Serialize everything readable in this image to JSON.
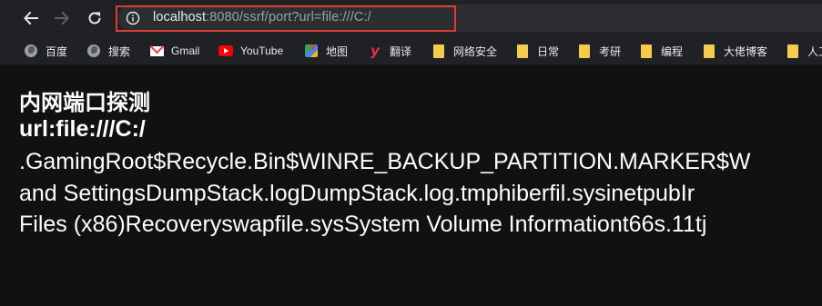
{
  "toolbar": {
    "url_host": "localhost",
    "url_rest": ":8080/ssrf/port?url=file:///C:/"
  },
  "bookmarks": [
    {
      "label": "百度",
      "icon": "globe-icon"
    },
    {
      "label": "搜索",
      "icon": "globe-icon"
    },
    {
      "label": "Gmail",
      "icon": "gmail-icon"
    },
    {
      "label": "YouTube",
      "icon": "youtube-icon"
    },
    {
      "label": "地图",
      "icon": "maps-icon"
    },
    {
      "label": "翻译",
      "icon": "youdao-icon"
    },
    {
      "label": "网络安全",
      "icon": "folder-icon"
    },
    {
      "label": "日常",
      "icon": "folder-icon"
    },
    {
      "label": "考研",
      "icon": "folder-icon"
    },
    {
      "label": "编程",
      "icon": "folder-icon"
    },
    {
      "label": "大佬博客",
      "icon": "folder-icon"
    },
    {
      "label": "人工",
      "icon": "folder-icon"
    }
  ],
  "page": {
    "title": "内网端口探测",
    "url_line": "url:file:///C:/",
    "listing": [
      ".GamingRoot$Recycle.Bin$WINRE_BACKUP_PARTITION.MARKER$W",
      "and SettingsDumpStack.logDumpStack.log.tmphiberfil.sysinetpubIr",
      "Files (x86)Recoveryswapfile.sysSystem Volume Informationt66s.11tj"
    ]
  },
  "colors": {
    "highlight": "#e03c31",
    "folder": "#f7cb4d"
  }
}
